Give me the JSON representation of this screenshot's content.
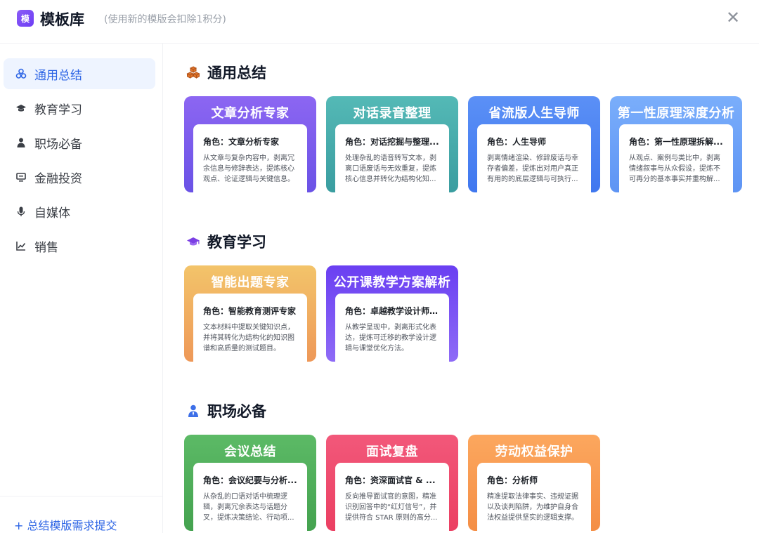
{
  "header": {
    "logo_text": "模",
    "title": "模板库",
    "subtitle": "(使用新的模版会扣除1积分)",
    "close_label": "✕"
  },
  "sidebar": {
    "items": [
      {
        "label": "通用总结",
        "icon": "cubes-icon",
        "active": true
      },
      {
        "label": "教育学习",
        "icon": "graduation-cap-icon"
      },
      {
        "label": "职场必备",
        "icon": "user-tie-icon"
      },
      {
        "label": "金融投资",
        "icon": "monitor-icon"
      },
      {
        "label": "自媒体",
        "icon": "microphone-icon"
      },
      {
        "label": "销售",
        "icon": "line-chart-icon"
      }
    ],
    "footer_link": "+ 总结模版需求提交"
  },
  "sections": [
    {
      "title": "通用总结",
      "icon": "cubes-icon",
      "cards": [
        {
          "title": "文章分析专家",
          "role": "角色：文章分析专家",
          "desc": "从文章与复杂内容中，剥离冗余信息与修辞表达，提炼核心观点、论证逻辑与关键信息。"
        },
        {
          "title": "对话录音整理",
          "role": "角色：对话挖掘与整理...",
          "desc": "处理杂乱的语音转写文本，剥离口语废话与无效重复，提炼核心信息并转化为结构化知..."
        },
        {
          "title": "省流版人生导师",
          "role": "角色：人生导师",
          "desc": "剥离情绪渲染、修辞废话与幸存者偏差，提炼出对用户真正有用的的底层逻辑与可执行..."
        },
        {
          "title": "第一性原理深度分析",
          "role": "角色：第一性原理拆解...",
          "desc": "从观点、案例与类比中，剥离情绪叙事与从众假设，提炼不可再分的基本事实并重构解..."
        }
      ]
    },
    {
      "title": "教育学习",
      "icon": "graduation-cap-icon",
      "cards": [
        {
          "title": "智能出题专家",
          "role": "角色：智能教育测评专家",
          "desc": "文本材料中提取关键知识点，并将其转化为结构化的知识图谱和高质量的测试题目。"
        },
        {
          "title": "公开课教学方案解析",
          "role": "角色：卓越教学设计师 ...",
          "desc": "从教学呈现中，剥离形式化表达，提炼可迁移的教学设计逻辑与课堂优化方法。"
        }
      ]
    },
    {
      "title": "职场必备",
      "icon": "user-tie-icon",
      "cards": [
        {
          "title": "会议总结",
          "role": "角色：会议纪要与分析...",
          "desc": "从杂乱的口语对话中梳理逻辑，剥离冗余表达与话题分叉，提炼决策结论、行动项..."
        },
        {
          "title": "面试复盘",
          "role": "角色：资深面试官 & ...",
          "desc": "反向推导面试官的意图，精准识别回答中的“红灯信号”，并提供符合 STAR 原则的高分..."
        },
        {
          "title": "劳动权益保护",
          "role": "角色：分析师",
          "desc": "精准提取法律事实、违规证据以及谈判陷阱，为维护自身合法权益提供坚实的逻辑支撑。"
        }
      ]
    }
  ],
  "colors": {
    "accent": "#2c64e5",
    "active_bg": "#eef4ff",
    "purple": "#7b5cf0",
    "teal": "#3fa7a8",
    "blue": "#4f86f5",
    "light_blue": "#6ea2f8",
    "orange": "#ef9f55",
    "violet": "#7348f3",
    "green": "#4caf57",
    "pink": "#f04a6c",
    "amber": "#f99a4e"
  }
}
